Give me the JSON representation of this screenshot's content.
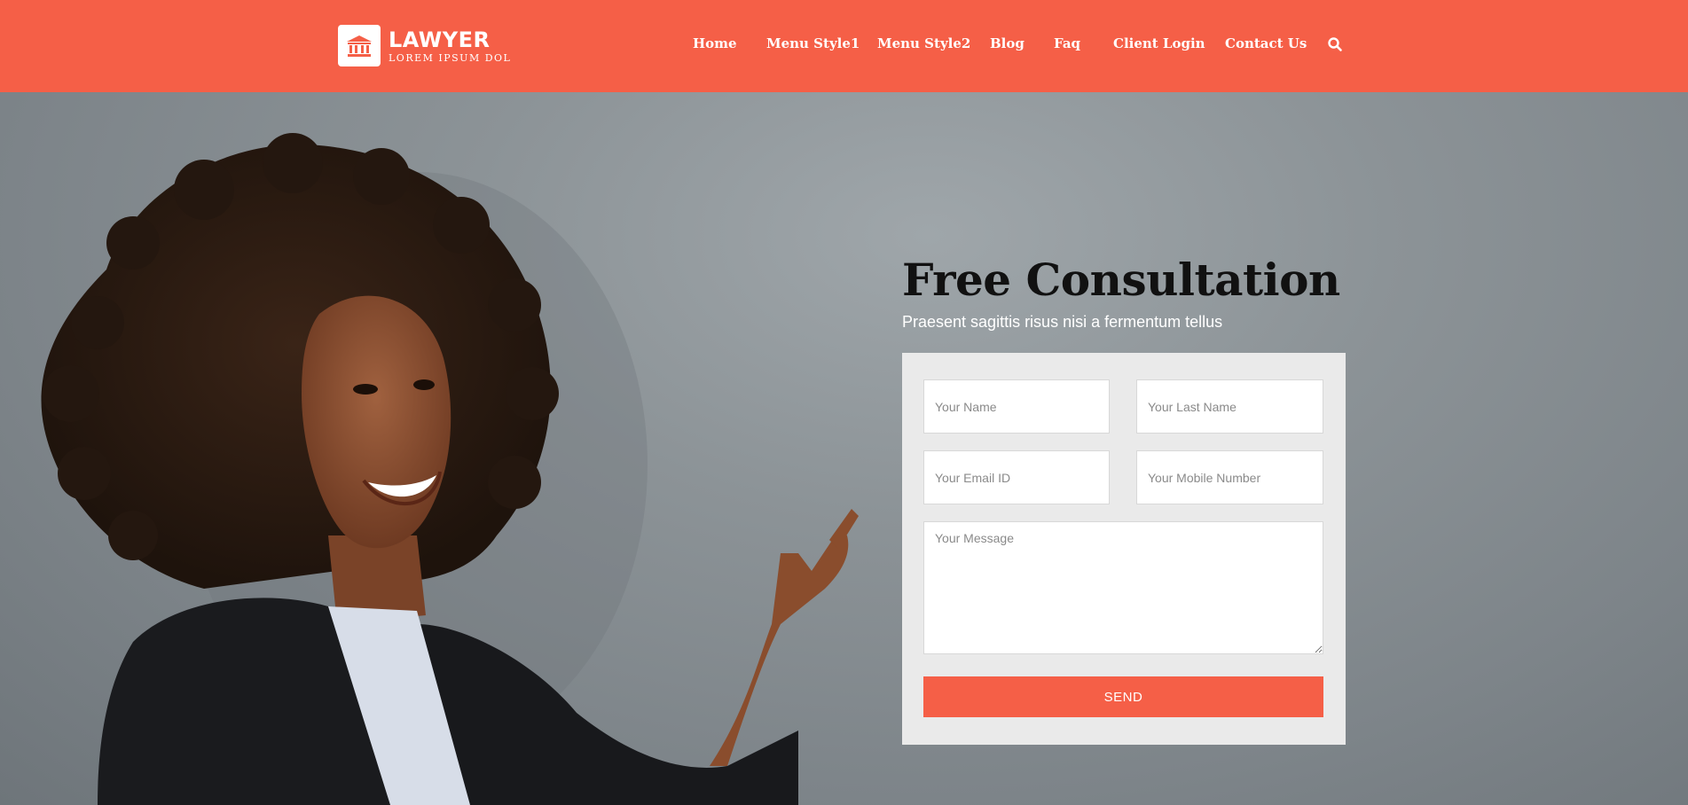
{
  "brand": {
    "name": "LAWYER",
    "tagline": "LOREM IPSUM DOL"
  },
  "nav": {
    "items": [
      {
        "label": "Home"
      },
      {
        "label": "Menu Style1"
      },
      {
        "label": "Menu Style2"
      },
      {
        "label": "Blog"
      },
      {
        "label": "Faq"
      },
      {
        "label": "Client Login"
      },
      {
        "label": "Contact Us"
      }
    ],
    "search_icon": "search-icon"
  },
  "hero": {
    "title": "Free Consultation",
    "subtitle": "Praesent sagittis risus nisi a fermentum tellus"
  },
  "form": {
    "first_name_placeholder": "Your Name",
    "last_name_placeholder": "Your Last Name",
    "email_placeholder": "Your Email ID",
    "mobile_placeholder": "Your Mobile Number",
    "message_placeholder": "Your Message",
    "send_label": "SEND"
  },
  "colors": {
    "brand": "#f55f47",
    "panel": "#eaeaea",
    "title": "#111111"
  }
}
